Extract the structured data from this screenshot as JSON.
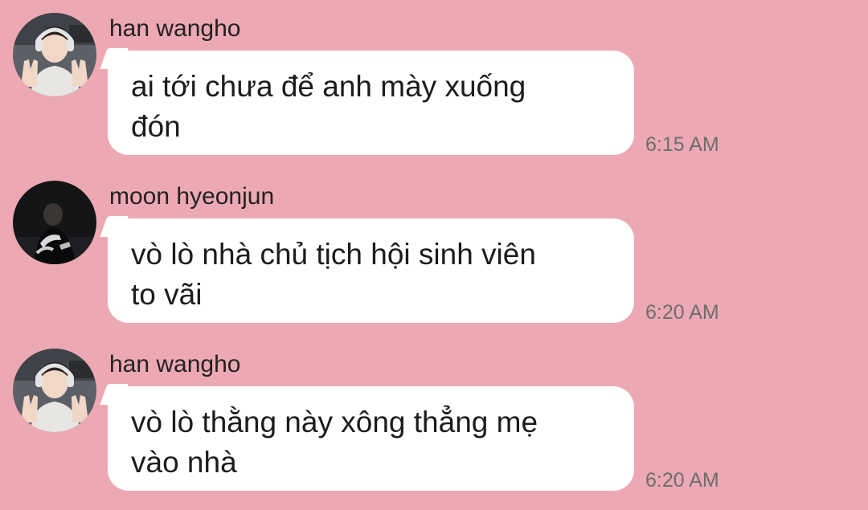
{
  "messages": [
    {
      "sender": "han wangho",
      "avatar": "avatar-photo-han-wangho",
      "lines": [
        "ai tới chưa để anh mày xuống",
        "đón"
      ],
      "time": "6:15 AM"
    },
    {
      "sender": "moon hyeonjun",
      "avatar": "avatar-photo-moon-hyeonjun",
      "lines": [
        "vò lò nhà chủ tịch hội sinh viên",
        "to vãi"
      ],
      "time": "6:20 AM"
    },
    {
      "sender": "han wangho",
      "avatar": "avatar-photo-han-wangho",
      "lines": [
        "vò lò thằng này xông thẳng mẹ",
        "vào nhà"
      ],
      "time": "6:20 AM"
    }
  ],
  "colors": {
    "background": "#eda9b3",
    "bubble": "#ffffff",
    "text": "#1c1c1c",
    "timestamp": "#6d6d6d"
  }
}
